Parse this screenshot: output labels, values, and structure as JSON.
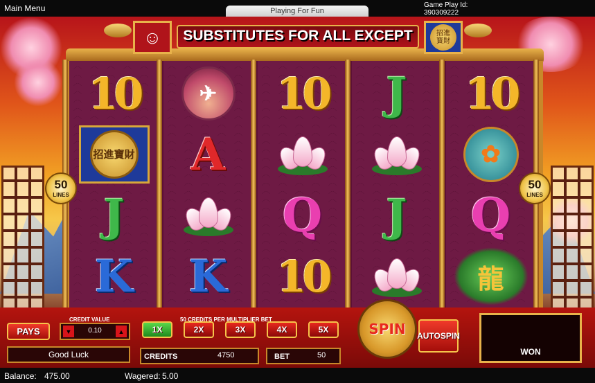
{
  "topbar": {
    "main_menu": "Main Menu",
    "playing_for_fun": "Playing For Fun",
    "game_play_id_label": "Game Play Id:",
    "game_play_id": "390309222"
  },
  "banner": {
    "text": "SUBSTITUTES FOR ALL EXCEPT",
    "cat_icon": "lucky-cat-icon",
    "bonus_coin": "bonus-coin-icon"
  },
  "lines": {
    "left_count": "50",
    "left_label": "LINES",
    "right_count": "50",
    "right_label": "LINES"
  },
  "reels": [
    [
      {
        "type": "ten",
        "label": "10"
      },
      {
        "type": "coin",
        "label": "招進寶財"
      },
      {
        "type": "jack",
        "label": "J"
      },
      {
        "type": "king",
        "label": "K"
      }
    ],
    [
      {
        "type": "crane",
        "label": "crane-icon"
      },
      {
        "type": "ace",
        "label": "A"
      },
      {
        "type": "lotus",
        "label": "lotus-icon"
      },
      {
        "type": "king",
        "label": "K"
      }
    ],
    [
      {
        "type": "ten",
        "label": "10"
      },
      {
        "type": "lotus",
        "label": "lotus-icon"
      },
      {
        "type": "queen",
        "label": "Q"
      },
      {
        "type": "ten",
        "label": "10"
      }
    ],
    [
      {
        "type": "jack",
        "label": "J"
      },
      {
        "type": "lotus",
        "label": "lotus-icon"
      },
      {
        "type": "jack",
        "label": "J"
      },
      {
        "type": "lotus",
        "label": "lotus-icon"
      }
    ],
    [
      {
        "type": "ten",
        "label": "10"
      },
      {
        "type": "koi",
        "label": "koi-icon"
      },
      {
        "type": "queen",
        "label": "Q"
      },
      {
        "type": "dragon",
        "label": "dragon-icon"
      }
    ]
  ],
  "controls": {
    "pays": "PAYS",
    "credit_value_label": "CREDIT VALUE",
    "credit_value": "0.10",
    "multiplier_label": "50 CREDITS PER MULTIPLIER BET",
    "multipliers": [
      "1X",
      "2X",
      "3X",
      "4X",
      "5X"
    ],
    "active_multiplier": "1X",
    "message": "Good Luck",
    "credits_label": "CREDITS",
    "credits_value": "4750",
    "bet_label": "BET",
    "bet_value": "50",
    "spin": "SPIN",
    "auto_spin_1": "AUTO",
    "auto_spin_2": "SPIN",
    "won_label": "WON"
  },
  "status": {
    "balance_label": "Balance:",
    "balance": "475.00",
    "wagered_label": "Wagered:",
    "wagered": "5.00"
  }
}
